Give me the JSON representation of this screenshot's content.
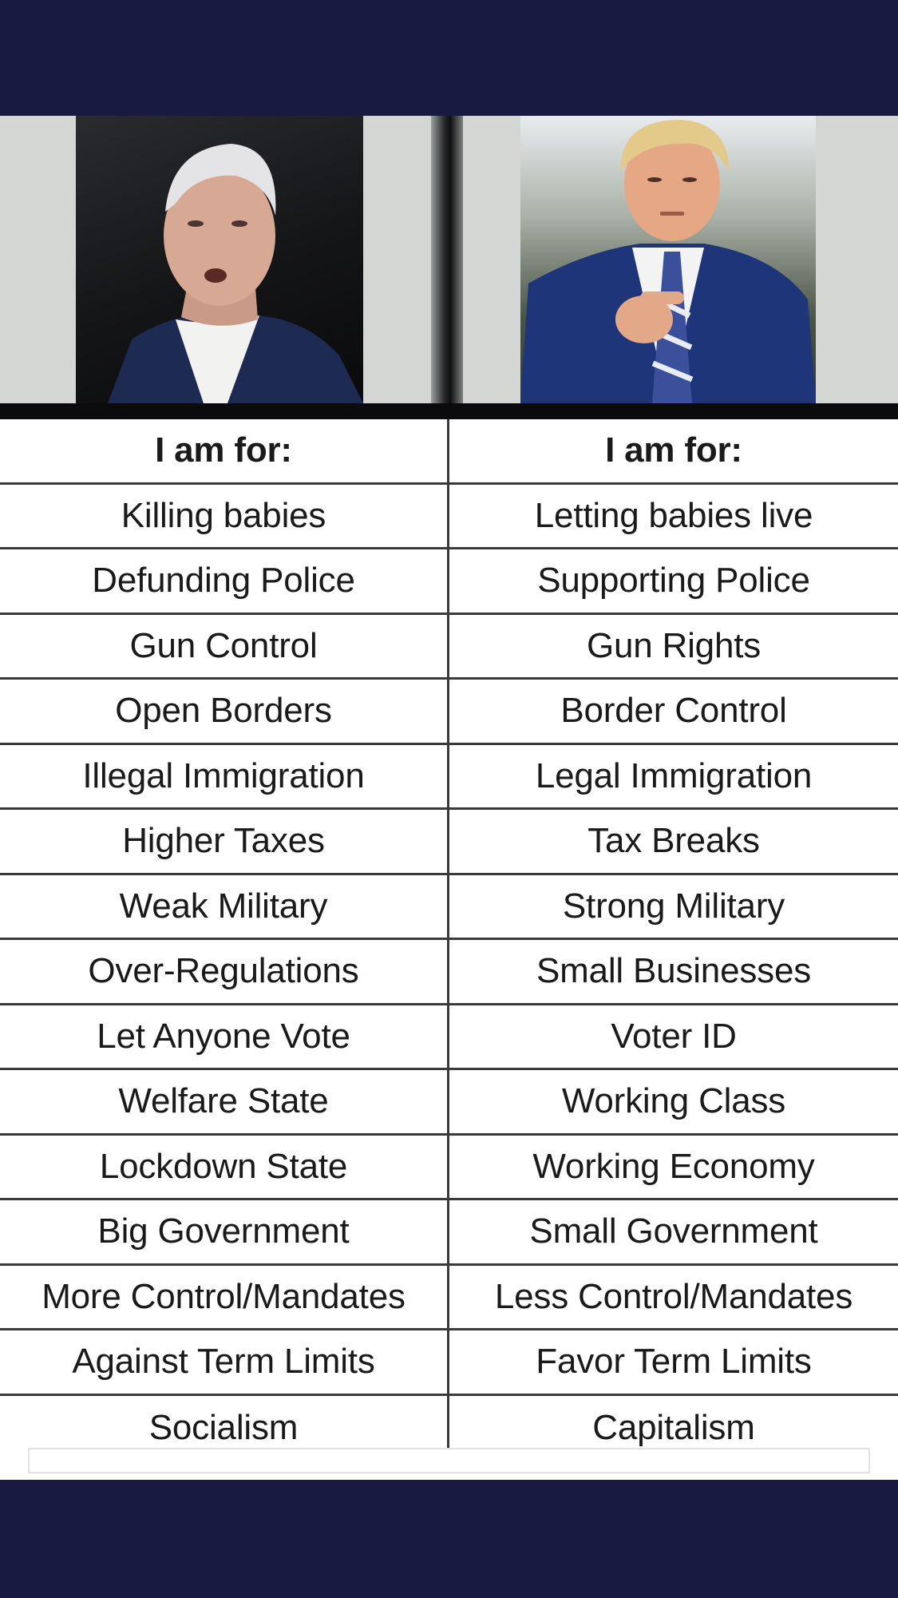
{
  "header": {
    "left": "I am for:",
    "right": "I am for:"
  },
  "rows": [
    {
      "left": "Killing babies",
      "right": "Letting babies live"
    },
    {
      "left": "Defunding Police",
      "right": "Supporting Police"
    },
    {
      "left": "Gun Control",
      "right": "Gun Rights"
    },
    {
      "left": "Open Borders",
      "right": "Border Control"
    },
    {
      "left": "Illegal Immigration",
      "right": "Legal Immigration"
    },
    {
      "left": "Higher Taxes",
      "right": "Tax Breaks"
    },
    {
      "left": "Weak Military",
      "right": "Strong Military"
    },
    {
      "left": "Over-Regulations",
      "right": "Small Businesses"
    },
    {
      "left": "Let Anyone Vote",
      "right": "Voter ID"
    },
    {
      "left": "Welfare State",
      "right": "Working Class"
    },
    {
      "left": "Lockdown State",
      "right": "Working Economy"
    },
    {
      "left": "Big Government",
      "right": "Small Government"
    },
    {
      "left": "More Control/Mandates",
      "right": "Less Control/Mandates"
    },
    {
      "left": "Against Term Limits",
      "right": "Favor Term Limits"
    },
    {
      "left": "Socialism",
      "right": "Capitalism"
    }
  ],
  "colors": {
    "frame": "#181a42",
    "grid_line": "#3a3a3a",
    "text": "#1a1a1a"
  }
}
